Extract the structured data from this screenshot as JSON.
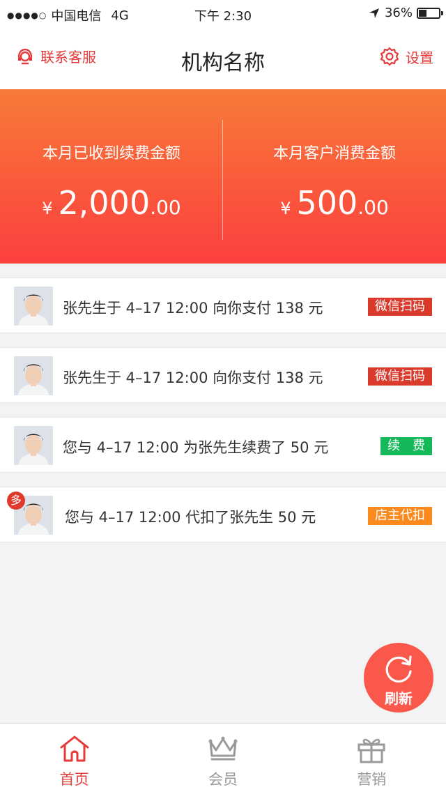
{
  "status_bar": {
    "carrier": "中国电信",
    "network": "4G",
    "time": "下午 2:30",
    "battery": "36%",
    "battery_level": 0.36
  },
  "nav": {
    "left_label": "联系客服",
    "title": "机构名称",
    "right_label": "设置"
  },
  "summary": {
    "left": {
      "label": "本月已收到续费金额",
      "currency": "¥",
      "integer": "2,000",
      "decimal": ".00"
    },
    "right": {
      "label": "本月客户消费金额",
      "currency": "¥",
      "integer": "500",
      "decimal": ".00"
    },
    "gradient_top": "#f87a38",
    "gradient_bottom": "#fb3f3f"
  },
  "records": [
    {
      "text": "张先生于 4–17 12:00 向你支付 138 元",
      "tag": "微信扫码",
      "tag_color": "#d93a2b",
      "multi": false
    },
    {
      "text": "张先生于 4–17 12:00 向你支付 138 元",
      "tag": "微信扫码",
      "tag_color": "#d93a2b",
      "multi": false
    },
    {
      "text": "您与 4–17 12:00 为张先生续费了 50 元",
      "tag": "续　费",
      "tag_color": "#15b85a",
      "multi": false
    },
    {
      "text": "您与 4–17 12:00 代扣了张先生 50 元",
      "tag": "店主代扣",
      "tag_color": "#fb8a1e",
      "multi": true,
      "multi_label": "多"
    }
  ],
  "refresh": {
    "label": "刷新",
    "color": "#f9584a"
  },
  "tabs": [
    {
      "label": "首页",
      "icon": "home-icon",
      "active": true
    },
    {
      "label": "会员",
      "icon": "crown-icon",
      "active": false
    },
    {
      "label": "营销",
      "icon": "gift-icon",
      "active": false
    }
  ]
}
